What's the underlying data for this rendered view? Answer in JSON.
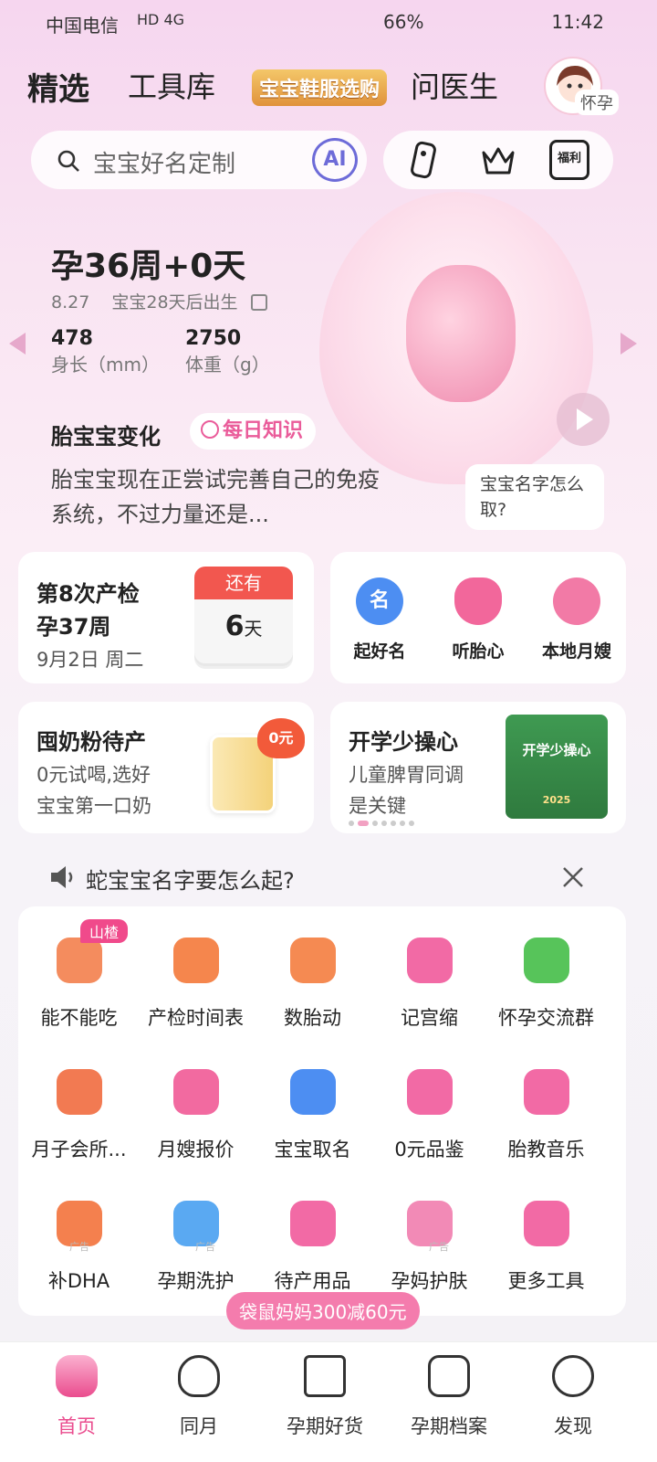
{
  "status": {
    "carrier": "中国电信",
    "network": "HD 4G",
    "battery": "66%",
    "time": "11:42"
  },
  "nav": {
    "tabs": [
      "精选",
      "工具库",
      "问医生"
    ],
    "promo": "宝宝鞋服选购",
    "avatar_tag": "怀孕"
  },
  "search": {
    "placeholder": "宝宝好名定制",
    "ai": "AI",
    "benefit": "福利"
  },
  "hero": {
    "week": "孕36周+0天",
    "date": "8.27",
    "due_text": "宝宝28天后出生",
    "length_value": "478",
    "length_label": "身长（mm）",
    "weight_value": "2750",
    "weight_label": "体重（g）",
    "change_title": "胎宝宝变化",
    "daily": "每日知识",
    "change_text": "胎宝宝现在正尝试完善自己的免疫系统，不过力量还是...",
    "bubble": "宝宝名字怎么取?"
  },
  "checkup": {
    "title1": "第8次产检",
    "title2": "孕37周",
    "date": "9月2日 周二",
    "remain_label": "还有",
    "remain_num": "6",
    "remain_unit": "天"
  },
  "quick": [
    {
      "label": "起好名",
      "color": "#4d8ef2"
    },
    {
      "label": "听胎心",
      "color": "#f2679b"
    },
    {
      "label": "本地月嫂",
      "color": "#f27aa6"
    }
  ],
  "promo1": {
    "title": "囤奶粉待产",
    "sub1": "0元试喝,选好",
    "sub2": "宝宝第一口奶",
    "tag": "0元"
  },
  "promo2": {
    "title": "开学少操心",
    "sub1": "儿童脾胃同调",
    "sub2": "是关键",
    "banner": "开学少操心",
    "year": "2025"
  },
  "notice": {
    "text": "蛇宝宝名字要怎么起?"
  },
  "grid": [
    {
      "label": "能不能吃",
      "color": "#f48c5e"
    },
    {
      "label": "产检时间表",
      "color": "#f5864d"
    },
    {
      "label": "数胎动",
      "color": "#f58a52"
    },
    {
      "label": "记宫缩",
      "color": "#f26aa5"
    },
    {
      "label": "怀孕交流群",
      "color": "#57c45a"
    },
    {
      "label": "月子会所...",
      "color": "#f27a52"
    },
    {
      "label": "月嫂报价",
      "color": "#f26aa0"
    },
    {
      "label": "宝宝取名",
      "color": "#4d8ef2"
    },
    {
      "label": "0元品鉴",
      "color": "#f26aa5"
    },
    {
      "label": "胎教音乐",
      "color": "#f26aa5"
    },
    {
      "label": "补DHA",
      "color": "#f4804e"
    },
    {
      "label": "孕期洗护",
      "color": "#5aa9f2"
    },
    {
      "label": "待产用品",
      "color": "#f26aa5"
    },
    {
      "label": "孕妈护肤",
      "color": "#f28ab6"
    },
    {
      "label": "更多工具",
      "color": "#f26aa5"
    }
  ],
  "grid_badge": "山楂",
  "ad_label": "广告",
  "coupon": "袋鼠妈妈300减60元",
  "bottom": [
    "首页",
    "同月",
    "孕期好货",
    "孕期档案",
    "发现"
  ]
}
